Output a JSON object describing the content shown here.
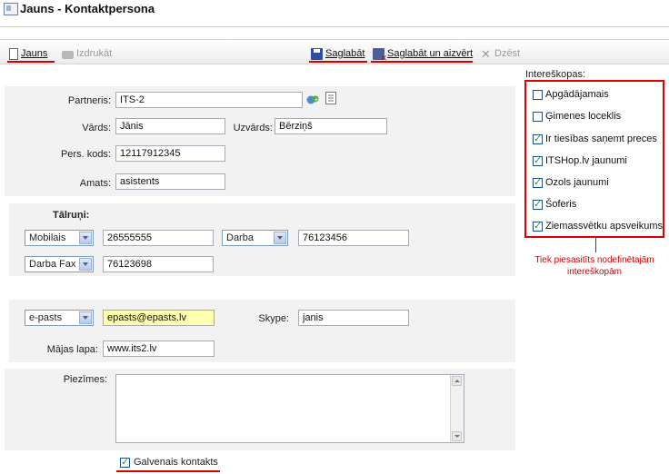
{
  "window": {
    "title": "Jauns - Kontaktpersona"
  },
  "toolbar": {
    "new_label": "Jauns",
    "print_label": "Izdrukāt",
    "save_label": "Saglabāt",
    "save_close_label": "Saglabāt un aizvērt",
    "delete_label": "Dzēst"
  },
  "form": {
    "partner_label": "Partneris:",
    "partner_value": "ITS-2",
    "first_name_label": "Vārds:",
    "first_name_value": "Jānis",
    "last_name_label": "Uzvārds:",
    "last_name_value": "Bērziņš",
    "personal_code_label": "Pers. kods:",
    "personal_code_value": "12117912345",
    "position_label": "Amats:",
    "position_value": "asistents"
  },
  "phones": {
    "title": "Tālruņi:",
    "rows": [
      {
        "type": "Mobilais",
        "value": "26555555"
      },
      {
        "type": "Darba",
        "value": "76123456"
      },
      {
        "type": "Darba Fax",
        "value": "76123698"
      }
    ]
  },
  "contacts": {
    "email_type": "e-pasts",
    "email_value": "epasts@epasts.lv",
    "skype_label": "Skype:",
    "skype_value": "janis",
    "homepage_label": "Mājas lapa:",
    "homepage_value": "www.its2.lv"
  },
  "notes": {
    "label": "Piezīmes:",
    "value": ""
  },
  "main_contact": {
    "label": "Galvenais kontakts",
    "checked": true
  },
  "interests": {
    "title": "Intereškopas:",
    "items": [
      {
        "label": "Apgādājamais",
        "checked": false
      },
      {
        "label": "Ģimenes loceklis",
        "checked": false
      },
      {
        "label": "Ir tiesības saņemt preces",
        "checked": true
      },
      {
        "label": "ITSHop.lv jaunumi",
        "checked": true
      },
      {
        "label": "Ozols jaunumi",
        "checked": true
      },
      {
        "label": "Šoferis",
        "checked": true
      },
      {
        "label": "Ziemassvētku apsveikums",
        "checked": true
      }
    ],
    "callout": "Tiek piesasitīts nodefinētajām intereškopām"
  },
  "colors": {
    "highlight": "#d40000",
    "panel": "#f2f2f2",
    "email_bg": "#ffffb0"
  }
}
